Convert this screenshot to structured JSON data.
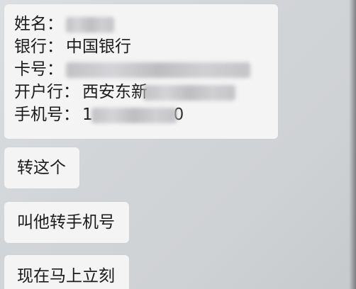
{
  "info_message": {
    "name_label": "姓名：",
    "bank_label": "银行：",
    "bank_value": "中国银行",
    "card_label": "卡号：",
    "branch_label": "开户行：",
    "branch_value_visible": "西安东新",
    "phone_label": "手机号：",
    "phone_prefix_visible": "1",
    "phone_suffix_visible": "0"
  },
  "messages": [
    {
      "text": "转这个"
    },
    {
      "text": "叫他转手机号"
    },
    {
      "text": "现在马上立刻"
    }
  ]
}
